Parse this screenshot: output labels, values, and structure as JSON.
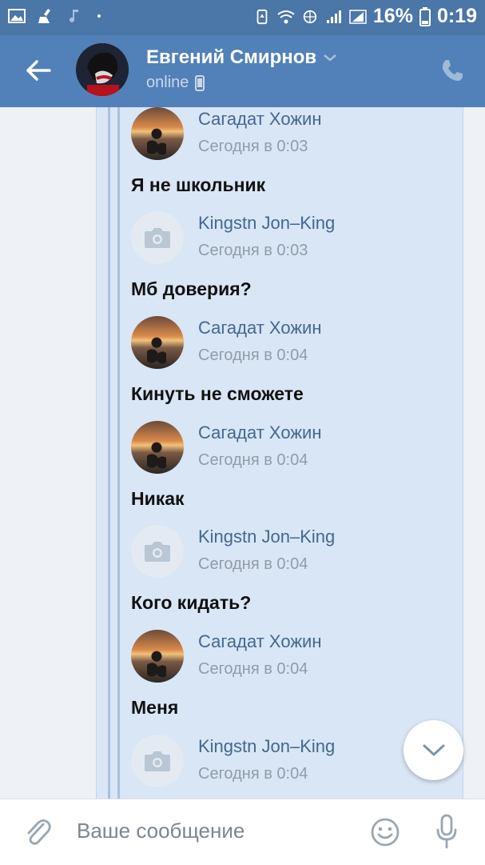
{
  "status_bar": {
    "battery": "16%",
    "time": "0:19",
    "icons": [
      "image-icon",
      "cleaner-icon",
      "music-note-icon",
      "dot-icon",
      "battery-saver-icon",
      "wifi-icon",
      "hotspot-icon",
      "signal-icon",
      "signal-icon",
      "battery-icon"
    ]
  },
  "header": {
    "name": "Евгений Смирнов",
    "status": "online",
    "icons": [
      "back-arrow-icon",
      "chevron-down-icon",
      "mobile-icon",
      "phone-icon"
    ]
  },
  "messages": [
    {
      "author": "Сагадат Хожин",
      "time": "Сегодня в 0:03",
      "avatar": "photo",
      "text": "Я не школьник"
    },
    {
      "author": "Kingstn Jon–King",
      "time": "Сегодня в 0:03",
      "avatar": "camera",
      "text": "Мб доверия?"
    },
    {
      "author": "Сагадат Хожин",
      "time": "Сегодня в 0:04",
      "avatar": "photo",
      "text": "Кинуть не сможете"
    },
    {
      "author": "Сагадат Хожин",
      "time": "Сегодня в 0:04",
      "avatar": "photo",
      "text": "Никак"
    },
    {
      "author": "Kingstn Jon–King",
      "time": "Сегодня в 0:04",
      "avatar": "camera",
      "text": "Кого кидать?"
    },
    {
      "author": "Сагадат Хожин",
      "time": "Сегодня в 0:04",
      "avatar": "photo",
      "text": "Меня"
    },
    {
      "author": "Kingstn Jon–King",
      "time": "Сегодня в 0:04",
      "avatar": "camera",
      "text": ""
    }
  ],
  "composer": {
    "placeholder": "Ваше сообщение",
    "icons": [
      "paperclip-icon",
      "smile-icon",
      "microphone-icon"
    ]
  },
  "colors": {
    "header": "#5181b8",
    "status_bar": "#4a76a8",
    "bubble": "#d8e6f6",
    "link": "#45678f"
  }
}
